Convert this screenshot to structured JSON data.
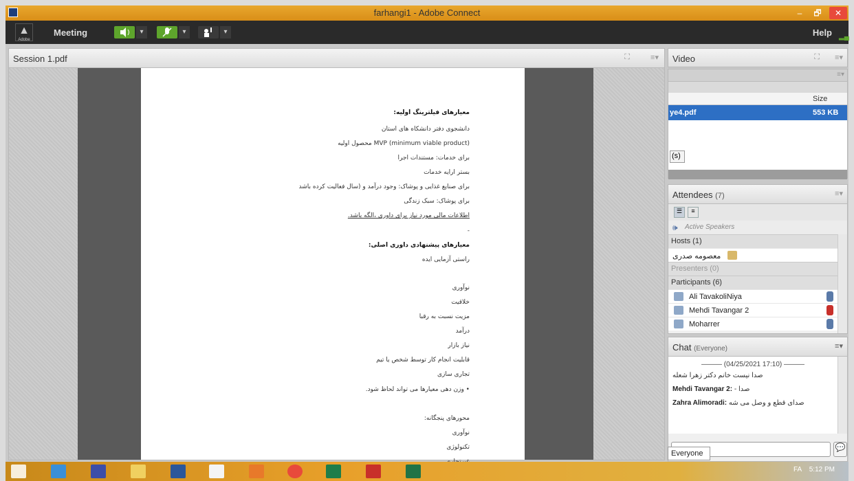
{
  "window": {
    "title": "farhangi1 - Adobe Connect",
    "min": "–",
    "max": "🗗",
    "close": "✕"
  },
  "appbar": {
    "logo_text": "Adobe",
    "meeting_menu": "Meeting",
    "help_menu": "Help"
  },
  "share_pod": {
    "title": "Session 1.pdf",
    "lines": [
      {
        "text": "معیارهای فیلترینگ اولیه:",
        "bold": true
      },
      {
        "text": "دانشجوی دفتر دانشکاه های استان",
        "bold": false
      },
      {
        "text": "(minimum viable product) MVP محصول اولیه",
        "bold": false
      },
      {
        "text": "برای خدمات: مستندات اجرا",
        "bold": false
      },
      {
        "text": "بستر ارایه خدمات",
        "bold": false
      },
      {
        "text": "برای صنایع غذایی و پوشاک: وجود درآمد و  (سال فعالیت کرده باشد",
        "bold": false
      },
      {
        "text": "برای پوشاک: سبک زندگی",
        "bold": false
      },
      {
        "text": "اطلاعات مالی مورد نیاز برای داوری ،الگه باشد.",
        "bold": false
      },
      {
        "text": "-",
        "bold": false
      },
      {
        "text": "معیارهای پیشنهادی داوری اصلی:",
        "bold": true
      },
      {
        "text": "راستی آزمایی ایده",
        "bold": false
      },
      {
        "text": "نوآوری",
        "bold": false
      },
      {
        "text": "خلاقیت",
        "bold": false
      },
      {
        "text": "مزیت نسبت به رقبا",
        "bold": false
      },
      {
        "text": "درآمد",
        "bold": false
      },
      {
        "text": "نیاز بازار",
        "bold": false
      },
      {
        "text": "قابلیت انجام کار توسط شخص یا تیم",
        "bold": false
      },
      {
        "text": "تجاری سازی",
        "bold": false
      },
      {
        "text": "•   وزن دهی معیارها می تواند لحاظ شود.",
        "bold": false
      },
      {
        "text": "محورهای پنجگانه:",
        "bold": false
      },
      {
        "text": "نوآوری",
        "bold": false
      },
      {
        "text": "تکنولوژی",
        "bold": false
      },
      {
        "text": "غیرتجاری",
        "bold": false
      }
    ]
  },
  "video_pod": {
    "title": "Video"
  },
  "files_pod": {
    "size_header": "Size",
    "file_name": "ye4.pdf",
    "file_size": "553 KB",
    "button_label": "(s)"
  },
  "attendees_pod": {
    "title": "Attendees",
    "count": "(7)",
    "active_speakers": "Active Speakers",
    "groups": {
      "hosts": "Hosts (1)",
      "presenters": "Presenters (0)",
      "participants": "Participants (6)"
    },
    "host_name": "معصومه صدری",
    "participants": [
      {
        "name": "Ali TavakoliNiya",
        "mic": "on"
      },
      {
        "name": "Mehdi Tavangar 2",
        "mic": "muted"
      },
      {
        "name": "Moharrer",
        "mic": "on"
      }
    ]
  },
  "chat_pod": {
    "title": "Chat",
    "scope": "(Everyone)",
    "timestamp": "(04/25/2021 17:10)",
    "messages": [
      {
        "sender": "",
        "text": "صدا نیست خانم دکتر زهرا شعله"
      },
      {
        "sender": "Mehdi Tavangar 2:",
        "text": "- صدا"
      },
      {
        "sender": "Zahra Alimoradi:",
        "text": "صدای قطع و وصل می شه"
      }
    ],
    "recipient_tab": "Everyone"
  },
  "taskbar": {
    "clock": "5:12 PM",
    "lang": "FA"
  }
}
